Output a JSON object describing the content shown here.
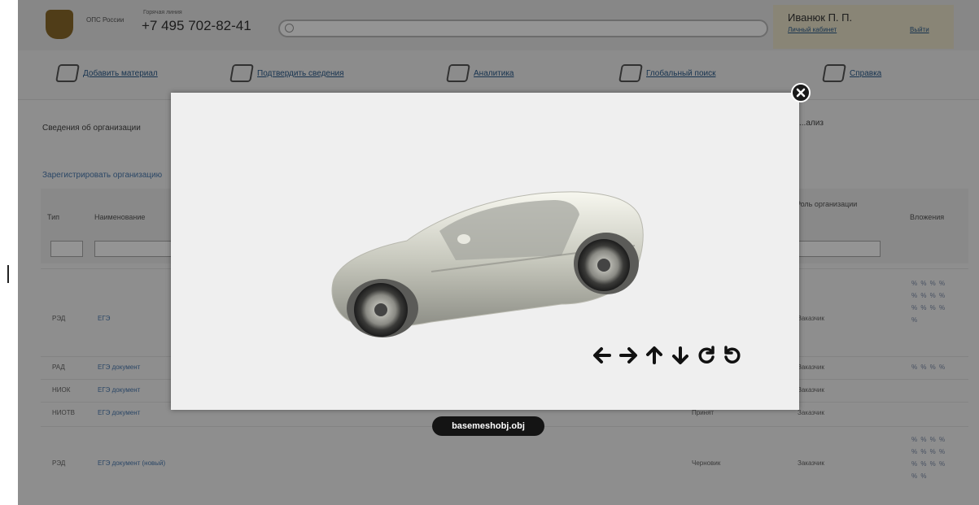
{
  "header": {
    "org_name": "ОПС России",
    "phone_caption": "Горячая линия",
    "phone": "+7 495 702-82-41",
    "user_name": "Иванюк П. П.",
    "cabinet_link": "Личный кабинет",
    "logout_link": "Выйти"
  },
  "nav": {
    "items": [
      {
        "label": "Добавить материал",
        "icon": "notebook-pen-icon"
      },
      {
        "label": "Подтвердить сведения",
        "icon": "notebook-pen-icon"
      },
      {
        "label": "Аналитика",
        "icon": "analytics-icon"
      },
      {
        "label": "Глобальный поиск",
        "icon": "globe-search-icon"
      },
      {
        "label": "Справка",
        "icon": "help-book-icon"
      }
    ]
  },
  "content": {
    "section_title": "Сведения об организации",
    "section_title_right": "...ализ",
    "add_org_link": "Зарегистрировать организацию",
    "columns": {
      "type": "Тип",
      "name": "Наименование",
      "role": "Роль организации",
      "attachments": "Вложения"
    },
    "rows": [
      {
        "type": "РЭД",
        "name": "ЕГЭ",
        "status": "",
        "role": "Заказчик",
        "att": "% % % %\n% % % %\n% % % %\n%"
      },
      {
        "type": "РАД",
        "name": "ЕГЭ документ",
        "status": "",
        "role": "Заказчик",
        "att": "% % % %"
      },
      {
        "type": "НИОК",
        "name": "ЕГЭ документ",
        "status": "",
        "role": "Заказчик",
        "att": ""
      },
      {
        "type": "НИОТВ",
        "name": "ЕГЭ документ",
        "status": "Принят",
        "role": "Заказчик",
        "att": ""
      },
      {
        "type": "РЭД",
        "name": "ЕГЭ документ (новый)",
        "status": "Черновик",
        "role": "Заказчик",
        "att": "% % % %\n% % % %\n% % % %\n% %"
      }
    ]
  },
  "viewer": {
    "filename": "basemeshobj.obj",
    "model_icon": "car-3d-model",
    "controls": [
      {
        "icon": "arrow-left-icon",
        "glyph": "🡐"
      },
      {
        "icon": "arrow-right-icon",
        "glyph": "🡒"
      },
      {
        "icon": "arrow-up-icon",
        "glyph": "🡑"
      },
      {
        "icon": "arrow-down-icon",
        "glyph": "🡓"
      },
      {
        "icon": "rotate-clockwise-icon",
        "glyph": "↻"
      },
      {
        "icon": "rotate-counterclockwise-icon",
        "glyph": "↺"
      }
    ],
    "close_icon": "close-icon"
  },
  "colors": {
    "overlay": "#000000",
    "modal_bg": "#efefef",
    "filename_badge": "#141414",
    "link": "#2a5a8a"
  }
}
